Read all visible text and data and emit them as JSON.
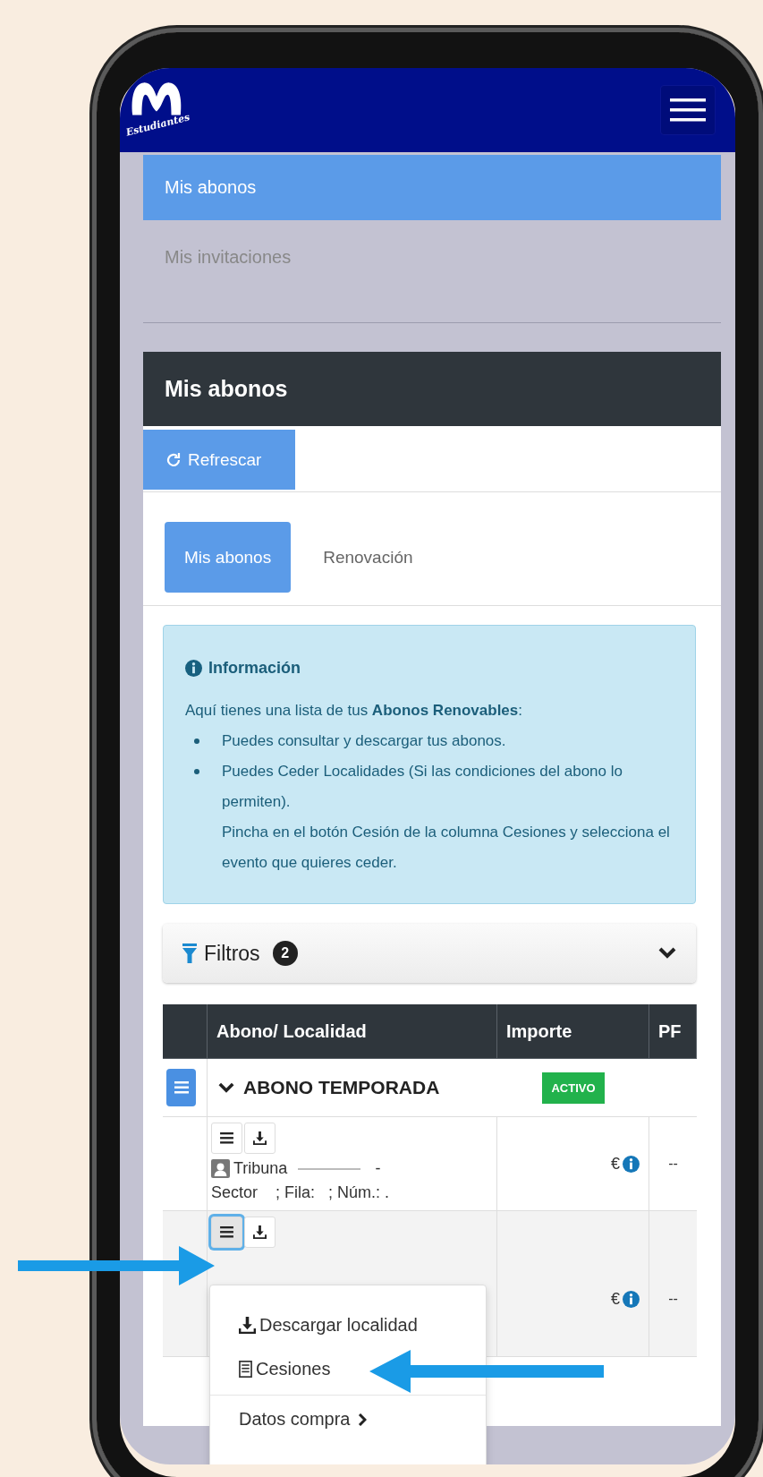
{
  "navbar": {
    "logo_text": "Estudiantes"
  },
  "nav_items": [
    {
      "label": "Mis abonos",
      "selected": true
    },
    {
      "label": "Mis invitaciones",
      "selected": false
    }
  ],
  "card": {
    "title": "Mis abonos",
    "refresh_button": "Refrescar"
  },
  "tabs": [
    {
      "label": "Mis abonos",
      "selected": true
    },
    {
      "label": "Renovación",
      "selected": false
    }
  ],
  "info": {
    "title": "Información",
    "intro": "Aquí tienes una lista de tus **Abonos Renovables**:",
    "bullets": [
      "Puedes consultar y descargar tus abonos.",
      "Puedes Ceder Localidades (Si las condiciones del abono lo permiten)."
    ],
    "note": "Pincha en el botón Cesión de la columna Cesiones y selecciona el evento que quieres ceder."
  },
  "filters": {
    "label": "Filtros",
    "count": "2"
  },
  "table": {
    "columns": [
      "Abono/ Localidad",
      "Importe",
      "PF"
    ],
    "group": {
      "title": "ABONO TEMPORADA",
      "status": "ACTIVO",
      "expanded": true
    },
    "rows": [
      {
        "stand": "Tribuna",
        "dash": "-",
        "location": "Sector    ; Fila:   ; Núm.: .",
        "amount": "€",
        "pf": "--",
        "highlighted": false,
        "menu_open": false
      },
      {
        "amount": "€",
        "pf": "--",
        "highlighted": true,
        "menu_open": true,
        "menu": [
          {
            "kind": "download",
            "label": "Descargar localidad"
          },
          {
            "kind": "list",
            "label": "Cesiones"
          },
          {
            "kind": "divider"
          },
          {
            "kind": "link",
            "label": "Datos compra"
          }
        ]
      }
    ]
  }
}
